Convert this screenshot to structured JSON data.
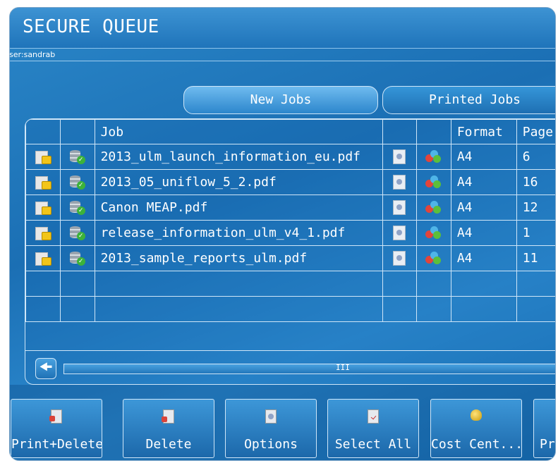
{
  "header": {
    "title": "SECURE QUEUE",
    "user": "lser:sandrab"
  },
  "tabs": [
    {
      "label": "New Jobs"
    },
    {
      "label": "Printed Jobs"
    }
  ],
  "table": {
    "columns": [
      "",
      "",
      "Job",
      "",
      "",
      "Format",
      "Page"
    ],
    "rows": [
      {
        "job": "2013_ulm_launch_information_eu.pdf",
        "format": "A4",
        "pages": "6"
      },
      {
        "job": "2013_05_uniflow_5_2.pdf",
        "format": "A4",
        "pages": "16"
      },
      {
        "job": "Canon MEAP.pdf",
        "format": "A4",
        "pages": "12"
      },
      {
        "job": "release_information_ulm_v4_1.pdf",
        "format": "A4",
        "pages": "1"
      },
      {
        "job": "2013_sample_reports_ulm.pdf",
        "format": "A4",
        "pages": "11"
      }
    ],
    "scroll_grip": "III"
  },
  "icons": {
    "locked_doc": "locked-document-icon",
    "server_ok": "server-check-icon",
    "doc_settings": "document-settings-icon",
    "color": "color-icon",
    "scroll_left": "arrow-left-icon"
  },
  "toolbar": {
    "buttons": [
      {
        "label": "Print+Delete",
        "icon": "print-delete-icon"
      },
      {
        "label": "Delete",
        "icon": "delete-icon"
      },
      {
        "label": "Options",
        "icon": "options-icon"
      },
      {
        "label": "Select All",
        "icon": "select-all-icon"
      },
      {
        "label": "Cost Cent...",
        "icon": "cost-center-icon"
      },
      {
        "label": "Pr",
        "icon": "print-icon"
      }
    ]
  },
  "colors": {
    "background": "#1f74ba",
    "border": "#cfe6f8",
    "text": "#ffffff",
    "lock": "#f2c51a",
    "check": "#3cb23a"
  }
}
